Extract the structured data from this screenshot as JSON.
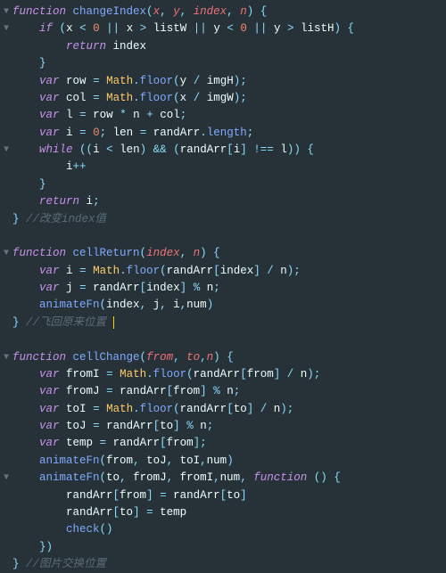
{
  "rows": [
    {
      "g": "▼",
      "h": "<span class='kw'>function</span> <span class='fn'>changeIndex</span><span class='pun'>(</span><span class='par'>x</span><span class='pun'>,</span> <span class='par'>y</span><span class='pun'>,</span> <span class='par'>index</span><span class='pun'>,</span> <span class='par'>n</span><span class='pun'>)</span> <span class='pun'>{</span>"
    },
    {
      "g": "▼",
      "h": "    <span class='kw'>if</span> <span class='pun'>(</span><span class='id'>x</span> <span class='op'>&lt;</span> <span class='num'>0</span> <span class='op'>||</span> <span class='id'>x</span> <span class='op'>&gt;</span> <span class='id'>listW</span> <span class='op'>||</span> <span class='id'>y</span> <span class='op'>&lt;</span> <span class='num'>0</span> <span class='op'>||</span> <span class='id'>y</span> <span class='op'>&gt;</span> <span class='id'>listH</span><span class='pun'>)</span> <span class='pun'>{</span>"
    },
    {
      "g": "",
      "h": "        <span class='kw'>return</span> <span class='id'>index</span>"
    },
    {
      "g": "",
      "h": "    <span class='pun'>}</span>"
    },
    {
      "g": "",
      "h": "    <span class='kw'>var</span> <span class='id'>row</span> <span class='op'>=</span> <span class='glo'>Math</span><span class='pun'>.</span><span class='mem'>floor</span><span class='pun'>(</span><span class='id'>y</span> <span class='op'>/</span> <span class='id'>imgH</span><span class='pun'>);</span>"
    },
    {
      "g": "",
      "h": "    <span class='kw'>var</span> <span class='id'>col</span> <span class='op'>=</span> <span class='glo'>Math</span><span class='pun'>.</span><span class='mem'>floor</span><span class='pun'>(</span><span class='id'>x</span> <span class='op'>/</span> <span class='id'>imgW</span><span class='pun'>);</span>"
    },
    {
      "g": "",
      "h": "    <span class='kw'>var</span> <span class='id'>l</span> <span class='op'>=</span> <span class='id'>row</span> <span class='op'>*</span> <span class='id'>n</span> <span class='op'>+</span> <span class='id'>col</span><span class='pun'>;</span>"
    },
    {
      "g": "",
      "h": "    <span class='kw'>var</span> <span class='id'>i</span> <span class='op'>=</span> <span class='num'>0</span><span class='pun'>;</span> <span class='id'>len</span> <span class='op'>=</span> <span class='id'>randArr</span><span class='pun'>.</span><span class='mem'>length</span><span class='pun'>;</span>"
    },
    {
      "g": "▼",
      "h": "    <span class='kw'>while</span> <span class='pun'>((</span><span class='id'>i</span> <span class='op'>&lt;</span> <span class='id'>len</span><span class='pun'>)</span> <span class='op'>&amp;&amp;</span> <span class='pun'>(</span><span class='id'>randArr</span><span class='pun'>[</span><span class='id'>i</span><span class='pun'>]</span> <span class='op'>!==</span> <span class='id'>l</span><span class='pun'>))</span> <span class='pun'>{</span>"
    },
    {
      "g": "",
      "h": "        <span class='id'>i</span><span class='op'>++</span>"
    },
    {
      "g": "",
      "h": "    <span class='pun'>}</span>"
    },
    {
      "g": "",
      "h": "    <span class='kw'>return</span> <span class='id'>i</span><span class='pun'>;</span>"
    },
    {
      "g": "",
      "h": "<span class='pun'>}</span> <span class='cmt'>//改变index值</span>"
    },
    {
      "g": "",
      "h": " "
    },
    {
      "g": "▼",
      "h": "<span class='kw'>function</span> <span class='fn'>cellReturn</span><span class='pun'>(</span><span class='par'>index</span><span class='pun'>,</span> <span class='par'>n</span><span class='pun'>)</span> <span class='pun'>{</span>"
    },
    {
      "g": "",
      "h": "    <span class='kw'>var</span> <span class='id'>i</span> <span class='op'>=</span> <span class='glo'>Math</span><span class='pun'>.</span><span class='mem'>floor</span><span class='pun'>(</span><span class='id'>randArr</span><span class='pun'>[</span><span class='id'>index</span><span class='pun'>]</span> <span class='op'>/</span> <span class='id'>n</span><span class='pun'>);</span>"
    },
    {
      "g": "",
      "h": "    <span class='kw'>var</span> <span class='id'>j</span> <span class='op'>=</span> <span class='id'>randArr</span><span class='pun'>[</span><span class='id'>index</span><span class='pun'>]</span> <span class='op'>%</span> <span class='id'>n</span><span class='pun'>;</span>"
    },
    {
      "g": "",
      "h": "    <span class='fn'>animateFn</span><span class='pun'>(</span><span class='id'>index</span><span class='pun'>,</span> <span class='id'>j</span><span class='pun'>,</span> <span class='id'>i</span><span class='pun'>,</span><span class='id'>num</span><span class='pun'>)</span>"
    },
    {
      "g": "",
      "h": "<span class='pun'>}</span> <span class='cmt'>//飞回原来位置<span class='cursor'> </span></span>"
    },
    {
      "g": "",
      "h": " "
    },
    {
      "g": "▼",
      "h": "<span class='kw'>function</span> <span class='fn'>cellChange</span><span class='pun'>(</span><span class='par'>from</span><span class='pun'>,</span> <span class='par'>to</span><span class='pun'>,</span><span class='par'>n</span><span class='pun'>)</span> <span class='pun'>{</span>"
    },
    {
      "g": "",
      "h": "    <span class='kw'>var</span> <span class='id'>fromI</span> <span class='op'>=</span> <span class='glo'>Math</span><span class='pun'>.</span><span class='mem'>floor</span><span class='pun'>(</span><span class='id'>randArr</span><span class='pun'>[</span><span class='id'>from</span><span class='pun'>]</span> <span class='op'>/</span> <span class='id'>n</span><span class='pun'>);</span>"
    },
    {
      "g": "",
      "h": "    <span class='kw'>var</span> <span class='id'>fromJ</span> <span class='op'>=</span> <span class='id'>randArr</span><span class='pun'>[</span><span class='id'>from</span><span class='pun'>]</span> <span class='op'>%</span> <span class='id'>n</span><span class='pun'>;</span>"
    },
    {
      "g": "",
      "h": "    <span class='kw'>var</span> <span class='id'>toI</span> <span class='op'>=</span> <span class='glo'>Math</span><span class='pun'>.</span><span class='mem'>floor</span><span class='pun'>(</span><span class='id'>randArr</span><span class='pun'>[</span><span class='id'>to</span><span class='pun'>]</span> <span class='op'>/</span> <span class='id'>n</span><span class='pun'>);</span>"
    },
    {
      "g": "",
      "h": "    <span class='kw'>var</span> <span class='id'>toJ</span> <span class='op'>=</span> <span class='id'>randArr</span><span class='pun'>[</span><span class='id'>to</span><span class='pun'>]</span> <span class='op'>%</span> <span class='id'>n</span><span class='pun'>;</span>"
    },
    {
      "g": "",
      "h": "    <span class='kw'>var</span> <span class='id'>temp</span> <span class='op'>=</span> <span class='id'>randArr</span><span class='pun'>[</span><span class='id'>from</span><span class='pun'>];</span>"
    },
    {
      "g": "",
      "h": "    <span class='fn'>animateFn</span><span class='pun'>(</span><span class='id'>from</span><span class='pun'>,</span> <span class='id'>toJ</span><span class='pun'>,</span> <span class='id'>toI</span><span class='pun'>,</span><span class='id'>num</span><span class='pun'>)</span>"
    },
    {
      "g": "▼",
      "h": "    <span class='fn'>animateFn</span><span class='pun'>(</span><span class='id'>to</span><span class='pun'>,</span> <span class='id'>fromJ</span><span class='pun'>,</span> <span class='id'>fromI</span><span class='pun'>,</span><span class='id'>num</span><span class='pun'>,</span> <span class='kw'>function</span> <span class='pun'>()</span> <span class='pun'>{</span>"
    },
    {
      "g": "",
      "h": "        <span class='id'>randArr</span><span class='pun'>[</span><span class='id'>from</span><span class='pun'>]</span> <span class='op'>=</span> <span class='id'>randArr</span><span class='pun'>[</span><span class='id'>to</span><span class='pun'>]</span>"
    },
    {
      "g": "",
      "h": "        <span class='id'>randArr</span><span class='pun'>[</span><span class='id'>to</span><span class='pun'>]</span> <span class='op'>=</span> <span class='id'>temp</span>"
    },
    {
      "g": "",
      "h": "        <span class='fn'>check</span><span class='pun'>()</span>"
    },
    {
      "g": "",
      "h": "    <span class='pun'>})</span>"
    },
    {
      "g": "",
      "h": "<span class='pun'>}</span> <span class='cmt'>//图片交换位置</span>"
    }
  ]
}
